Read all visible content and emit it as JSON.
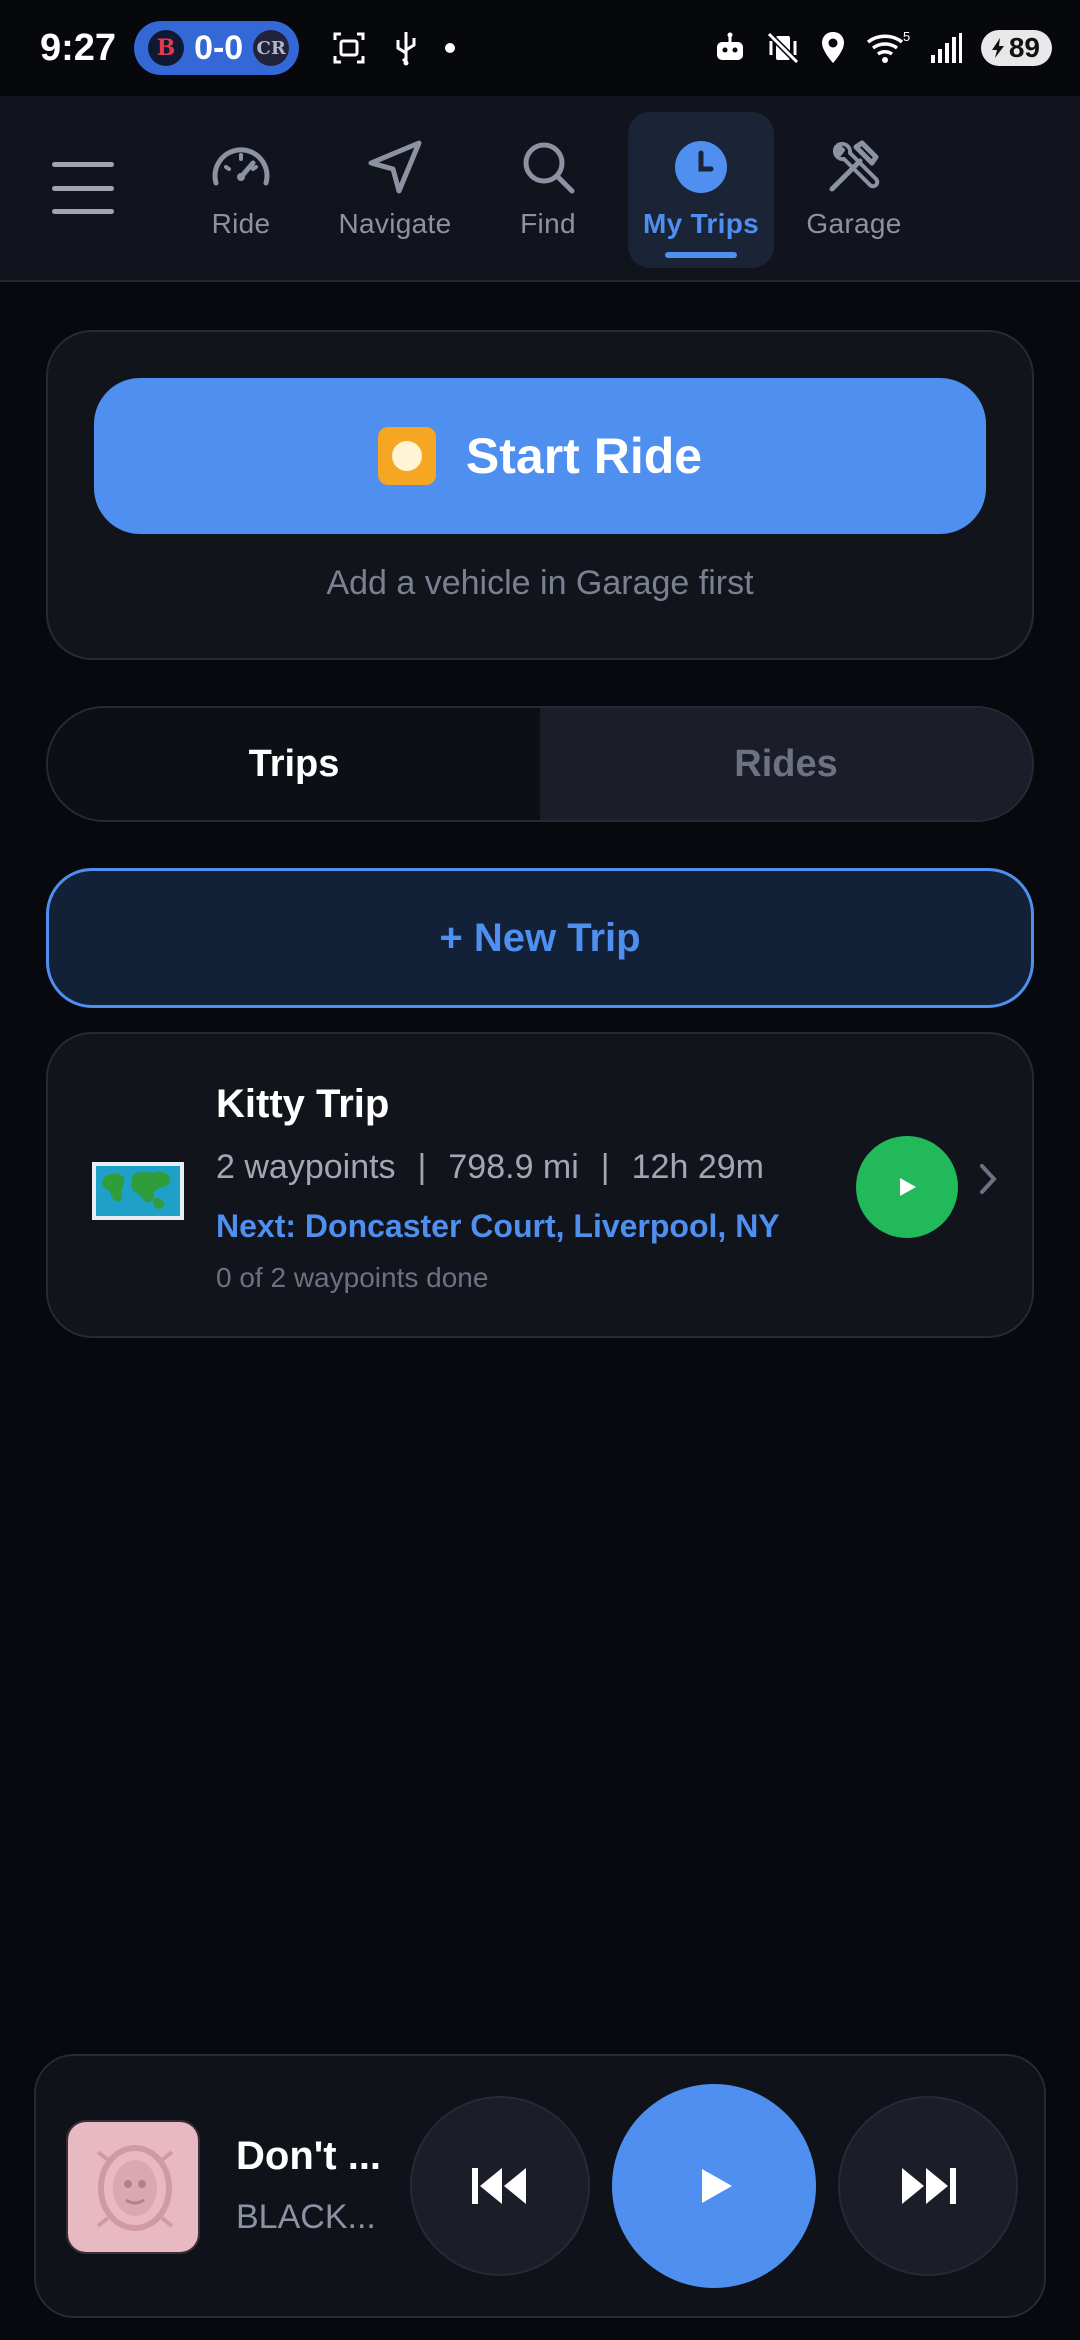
{
  "status_bar": {
    "time": "9:27",
    "score": "0-0",
    "team_left_logo": "B",
    "team_right_logo": "CR",
    "battery": "89",
    "signal_superscript": "5"
  },
  "nav": {
    "tabs": [
      {
        "label": "Ride",
        "icon": "speedometer-icon"
      },
      {
        "label": "Navigate",
        "icon": "navigation-arrow-icon"
      },
      {
        "label": "Find",
        "icon": "search-icon"
      },
      {
        "label": "My Trips",
        "icon": "clock-icon",
        "active": true
      },
      {
        "label": "Garage",
        "icon": "tools-icon"
      }
    ]
  },
  "start_card": {
    "button_label": "Start Ride",
    "hint": "Add a vehicle in Garage first"
  },
  "segment": {
    "trips_label": "Trips",
    "rides_label": "Rides",
    "selected": "Trips"
  },
  "new_trip": {
    "label": "+ New Trip"
  },
  "trip": {
    "title": "Kitty Trip",
    "waypoints": "2 waypoints",
    "distance": "798.9 mi",
    "duration": "12h 29m",
    "separator": "|",
    "next": "Next: Doncaster Court, Liverpool, NY",
    "progress": "0 of 2 waypoints done"
  },
  "player": {
    "title": "Don't ...",
    "artist": "BLACK..."
  },
  "colors": {
    "accent": "#4f8ff0",
    "play_green": "#21b95a",
    "background": "#07090e",
    "card": "#12141c"
  }
}
